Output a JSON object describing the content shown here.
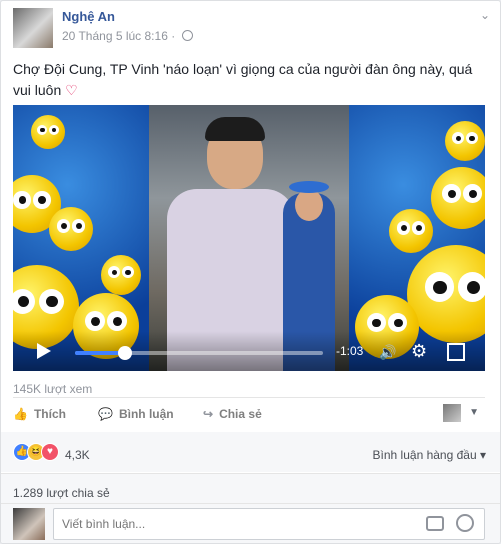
{
  "post": {
    "author": "Nghệ An",
    "timestamp": "20 Tháng 5 lúc 8:16 ·",
    "caption": "Chợ Đội Cung, TP Vinh 'náo loạn' vì giọng ca của người đàn ông này, quá vui luôn",
    "caption_emoji": "♡"
  },
  "video": {
    "time_left": "-1:03",
    "progress": 0.2,
    "icons": [
      "play-icon",
      "volume-icon",
      "settings-icon",
      "fullscreen-icon"
    ]
  },
  "stats": {
    "views": "145K lượt xem",
    "reactions": "4,3K",
    "shares": "1.289 lượt chia sẻ"
  },
  "actions": {
    "like": "Thích",
    "comment": "Bình luận",
    "share": "Chia sẻ"
  },
  "comments": {
    "sort_label": "Bình luận hàng đầu",
    "placeholder": "Viết bình luận..."
  },
  "colors": {
    "link": "#365899",
    "accent": "#4080ff"
  }
}
